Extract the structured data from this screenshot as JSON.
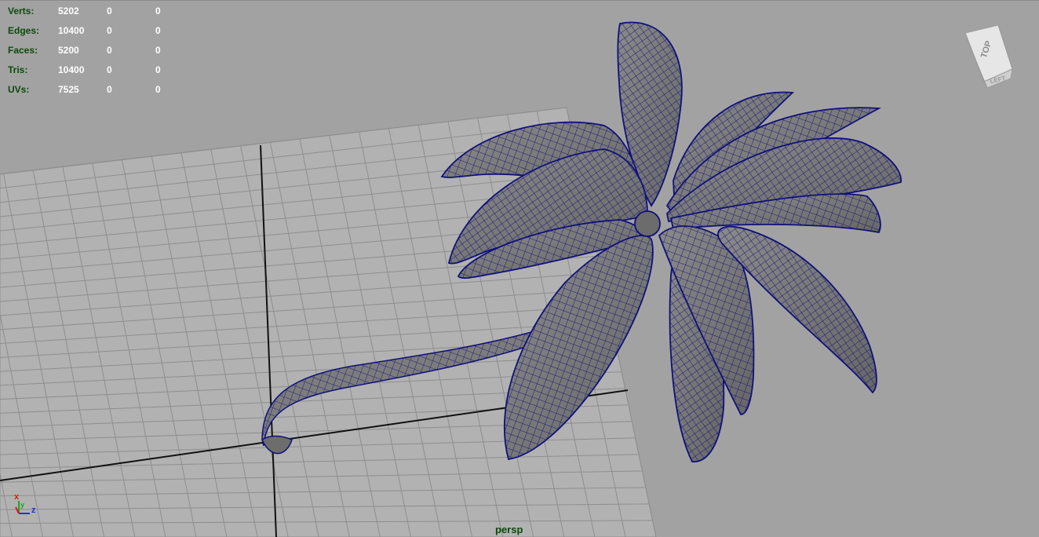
{
  "viewport": {
    "camera_label": "persp",
    "background": "#a2a2a2",
    "grid_color": "#8e8e8e",
    "grid_fill": "#b4b4b4",
    "axis_line_color": "#111111",
    "mesh_color": "#7c7c7c",
    "wire_color": "#10107a"
  },
  "heads_up": {
    "rows": [
      {
        "label": "Verts:",
        "v1": "5202",
        "v2": "0",
        "v3": "0"
      },
      {
        "label": "Edges:",
        "v1": "10400",
        "v2": "0",
        "v3": "0"
      },
      {
        "label": "Faces:",
        "v1": "5200",
        "v2": "0",
        "v3": "0"
      },
      {
        "label": "Tris:",
        "v1": "10400",
        "v2": "0",
        "v3": "0"
      },
      {
        "label": "UVs:",
        "v1": "7525",
        "v2": "0",
        "v3": "0"
      }
    ]
  },
  "view_cube": {
    "top_label": "TOP",
    "left_label": "LEFT",
    "icon": "view-cube-icon"
  },
  "axis_indicator": {
    "x_label": "x",
    "y_label": "y",
    "z_label": "z",
    "x_color": "#d81d1d",
    "y_color": "#1ea51e",
    "z_color": "#1d35d8"
  }
}
